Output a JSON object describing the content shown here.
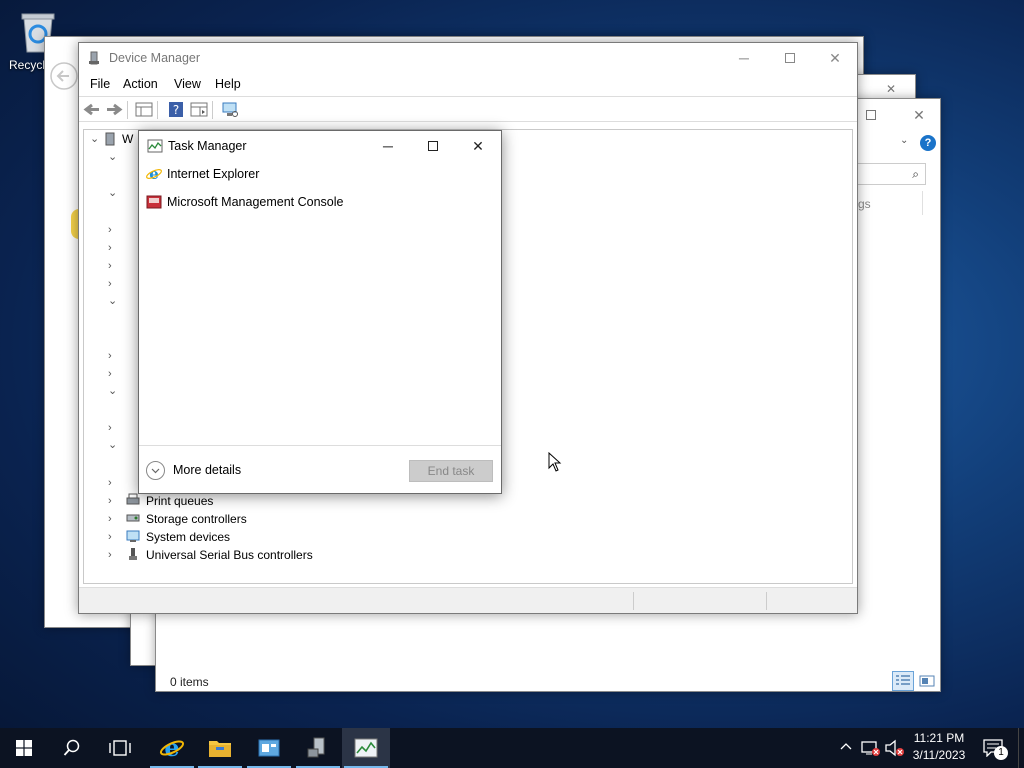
{
  "desktop": {
    "recycle_bin_label": "Recycl"
  },
  "device_manager": {
    "title": "Device Manager",
    "menu": [
      "File",
      "Action",
      "View",
      "Help"
    ],
    "tree_root": "W",
    "visible_items": [
      "Print queues",
      "Storage controllers",
      "System devices",
      "Universal Serial Bus controllers"
    ]
  },
  "task_manager": {
    "title": "Task Manager",
    "apps": [
      "Internet Explorer",
      "Microsoft Management Console"
    ],
    "more_details": "More details",
    "end_task": "End task"
  },
  "explorer": {
    "status": "0 items",
    "partial_text": "gs"
  },
  "taskbar": {
    "time": "11:21 PM",
    "date": "3/11/2023",
    "notification_count": "1"
  },
  "colors": {
    "accent": "#1a73c9",
    "taskbar": "#0c1322",
    "active_underline": "#76b9ed"
  }
}
